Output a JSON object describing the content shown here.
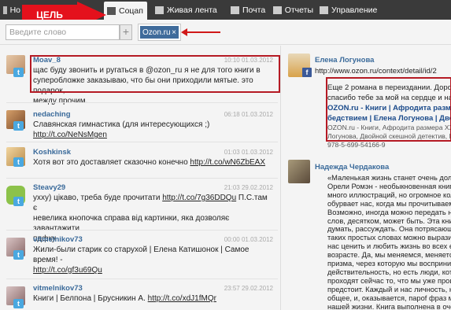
{
  "nav": {
    "tabs": [
      {
        "label": "Но"
      },
      {
        "label": "Соцап"
      },
      {
        "label": "Живая лента"
      },
      {
        "label": "Почта"
      },
      {
        "label": "Отчеты"
      },
      {
        "label": "Управление"
      }
    ]
  },
  "annotation": {
    "goal_label": "ЦЕЛЬ"
  },
  "search": {
    "placeholder": "Введите слово",
    "add_label": "+"
  },
  "filter_chip": {
    "label": "Ozon.ru",
    "remove": "×"
  },
  "left_posts": [
    {
      "author": "Moav_8",
      "date": "10:10 01.03.2012",
      "icon": "twitter-icon",
      "text1": "щас буду звонить и ругаться в @ozon_ru я не для того книги в",
      "text2": "суперобложке заказываю, что бы они приходили мятые. это подарок,",
      "text3": "между прочим."
    },
    {
      "author": "nedaching",
      "date": "06:18 01.03.2012",
      "icon": "twitter-icon",
      "text1": "Славянская гимнастика (для интересующихся ;) ",
      "link": "http://t.co/NeNsMgen"
    },
    {
      "author": "Koshkinsk",
      "date": "01:03 01.03.2012",
      "icon": "twitter-icon",
      "text1": "Хотя вот это доставляет сказочно конечно ",
      "link": "http://t.co/wN6ZbEAX"
    },
    {
      "author": "Steavy29",
      "date": "21:03 29.02.2012",
      "icon": "twitter-icon",
      "text1": "ухху) цікаво, треба буде прочитати ",
      "link": "http://t.co/7g36DDQu",
      "text1b": " П.С.там є",
      "text2": "невелика кнопочка справа від картинки, яка дозволяє завантажити",
      "text3": "пдфку"
    },
    {
      "author": "vitmelnikov73",
      "date": "00:00 01.03.2012",
      "icon": "twitter-icon",
      "text1": "Жили-были старик со старухой | Елена Катишонок | Самое время! -",
      "link2": "http://t.co/gf3u69Qu"
    },
    {
      "author": "vitmelnikov73",
      "date": "23:57 29.02.2012",
      "icon": "twitter-icon",
      "text1": "Книги | Белпона | Брусникин А. ",
      "link": "http://t.co/xdJ1fMQr"
    }
  ],
  "right_posts": [
    {
      "author": "Елена Логунова",
      "icon": "facebook-icon",
      "link": "http://www.ozon.ru/context/detail/id/2",
      "l1": "Еще 2 романа в переиздании. Дорого",
      "l2": "спасибо тебе за мой на сердце и нас",
      "b1": "OZON.ru - Книги | Афродита размера Х",
      "b2": "бедствием | Елена Логунова | Двойн",
      "s1": "OZON.ru - Книги, Афродита размера XXL. Бе",
      "s2": "Логунова, Двойной скешной детектив, Куры",
      "s3": "978-5-699-54166-9"
    },
    {
      "author": "Надежда Чердакова",
      "lines": [
        "«Маленькая жизнь станет очень долг",
        "Орели Ромэн - необыкновенная книга",
        "много иллюстраций, но огромное коли",
        "обурвает нас, когда мы прочитываем",
        "Возможно, иногда можно передать на",
        "слов, десятком, может быть. Эта книг",
        "думать, рассуждать. Она потрясающ",
        "таких простых словах можно выразит",
        "нас ценить и любить жизнь во всех е",
        "возрасте. Да, мы меняемся, меняется",
        "призма, через которую мы восприним",
        "действительность, но есть люди, кото",
        "проходят сейчас то, что мы уже проц",
        "предстоит. Каждый и нас личность, н",
        "общее, и, оказывается, пароf фраз м",
        "нашей жизни. Книга выполнена в оче"
      ]
    }
  ]
}
